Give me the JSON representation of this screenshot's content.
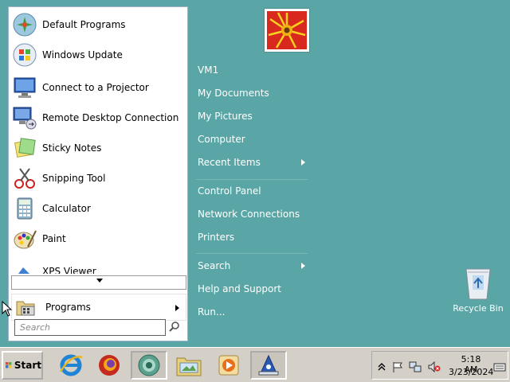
{
  "start_menu": {
    "programs": [
      {
        "label": "Default Programs",
        "icon": "default-programs-icon"
      },
      {
        "label": "Windows Update",
        "icon": "windows-update-icon"
      },
      {
        "label": "Connect to a Projector",
        "icon": "projector-icon"
      },
      {
        "label": "Remote Desktop Connection",
        "icon": "remote-desktop-icon"
      },
      {
        "label": "Sticky Notes",
        "icon": "sticky-notes-icon"
      },
      {
        "label": "Snipping Tool",
        "icon": "snipping-tool-icon"
      },
      {
        "label": "Calculator",
        "icon": "calculator-icon"
      },
      {
        "label": "Paint",
        "icon": "paint-icon"
      },
      {
        "label": "XPS Viewer",
        "icon": "xps-viewer-icon"
      }
    ],
    "all_programs_label": "Programs",
    "search_placeholder": "Search",
    "right_links": {
      "user": "VM1",
      "documents": "My Documents",
      "pictures": "My Pictures",
      "computer": "Computer",
      "recent": "Recent Items",
      "control_panel": "Control Panel",
      "network": "Network Connections",
      "printers": "Printers",
      "search": "Search",
      "help": "Help and Support",
      "run": "Run..."
    }
  },
  "desktop": {
    "recycle_bin_label": "Recycle Bin"
  },
  "taskbar": {
    "start_label": "Start",
    "apps": [
      "internet-explorer-icon",
      "firefox-icon",
      "browser-icon",
      "explorer-icon",
      "media-player-icon",
      "paint-app-icon"
    ],
    "clock_time": "5:18 AM",
    "clock_date": "3/23/2024"
  },
  "colors": {
    "desktop": "#5aa5a5",
    "menu_bg": "#ffffff",
    "taskbar": "#d4d0c8"
  }
}
